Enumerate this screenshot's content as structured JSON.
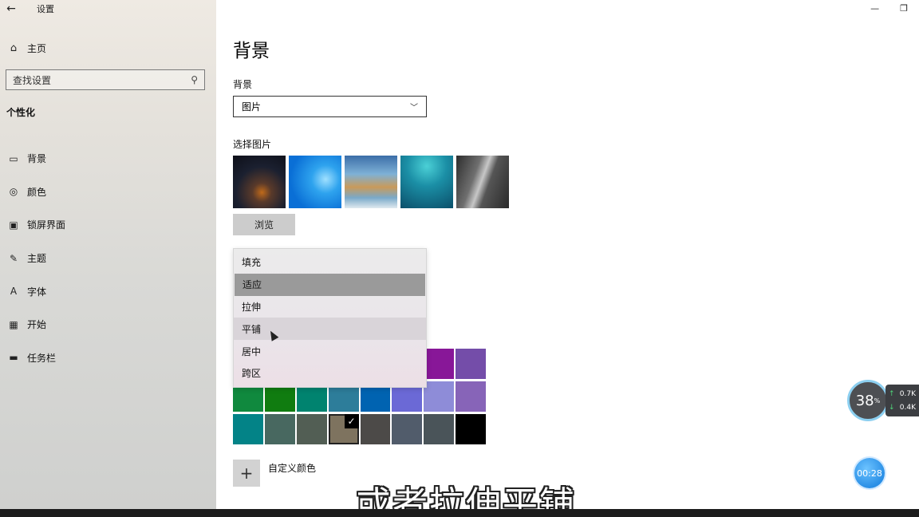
{
  "app": {
    "title": "设置",
    "back_icon": "←",
    "minimize_icon": "—",
    "restore_icon": "❐"
  },
  "sidebar": {
    "home_label": "主页",
    "search_placeholder": "查找设置",
    "section_title": "个性化",
    "items": [
      {
        "label": "背景",
        "icon": "▭"
      },
      {
        "label": "颜色",
        "icon": "◎"
      },
      {
        "label": "锁屏界面",
        "icon": "▣"
      },
      {
        "label": "主题",
        "icon": "✎"
      },
      {
        "label": "字体",
        "icon": "A"
      },
      {
        "label": "开始",
        "icon": "▦"
      },
      {
        "label": "任务栏",
        "icon": "▬"
      }
    ]
  },
  "main": {
    "page_title": "背景",
    "background_label": "背景",
    "background_value": "图片",
    "choose_picture_label": "选择图片",
    "browse_label": "浏览",
    "fit_options": [
      {
        "label": "填充",
        "state": "normal"
      },
      {
        "label": "适应",
        "state": "selected"
      },
      {
        "label": "拉伸",
        "state": "normal"
      },
      {
        "label": "平铺",
        "state": "hover"
      },
      {
        "label": "居中",
        "state": "normal"
      },
      {
        "label": "跨区",
        "state": "normal"
      }
    ],
    "colors": {
      "row1": [
        null,
        null,
        null,
        null,
        null,
        null,
        "#881798",
        "#744da9"
      ],
      "row2": [
        "#10893e",
        "#107c10",
        "#00836f",
        "#2d7d9a",
        "#0063b1",
        "#6b69d6",
        "#8e8cd8",
        "#8764b8"
      ],
      "row3": [
        "#038387",
        "#486860",
        "#525e54",
        "#7e735f",
        "#4c4a48",
        "#515c6b",
        "#4a5459",
        "#000000"
      ],
      "checked": {
        "row": 3,
        "index": 3
      },
      "check_icon": "✓"
    },
    "custom_color_label": "自定义颜色",
    "plus_icon": "+"
  },
  "overlay": {
    "subtitle": "或者拉伸平铺",
    "cpu_percent": "38",
    "cpu_unit": "%",
    "net_up": "0.7K",
    "net_down": "0.4K",
    "timer": "00:28"
  }
}
